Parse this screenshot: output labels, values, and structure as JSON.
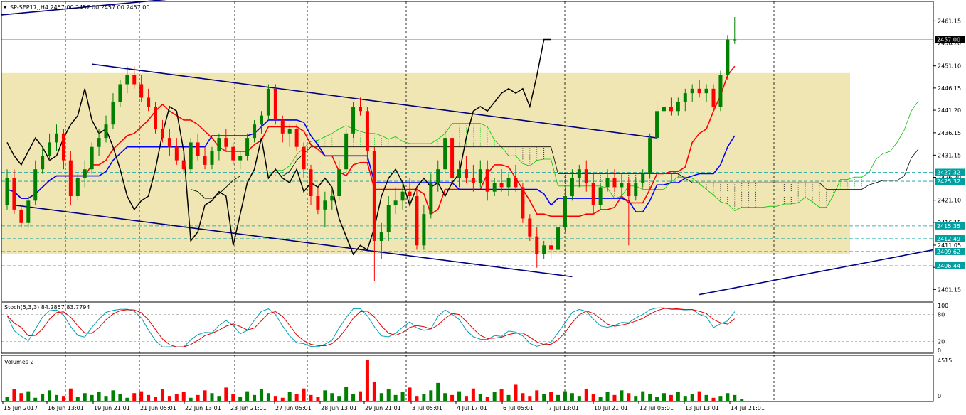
{
  "header": {
    "symbol_line": "SP-SEP17,,H4  2457.00 2457.00 2457.00 2457.00"
  },
  "chart_data": {
    "type": "candlestick",
    "symbol": "SP-SEP17",
    "timeframe": "H4",
    "price_axis": {
      "ylim": [
        2398.5,
        2465.5
      ],
      "ticks": [
        "2461.15",
        "2456.20",
        "2451.10",
        "2446.15",
        "2441.20",
        "2436.15",
        "2431.15",
        "2426.20",
        "2421.10",
        "2416.15",
        "2411.05",
        "2406.10",
        "2401.15"
      ],
      "current_price": "2457.00",
      "level_labels": [
        "2427.32",
        "2425.32",
        "2415.35",
        "2412.49",
        "2409.62",
        "2406.44"
      ],
      "level_values": [
        2427.32,
        2425.32,
        2415.35,
        2412.49,
        2409.62,
        2406.44
      ]
    },
    "time_axis": {
      "labels": [
        "15 Jun 2017",
        "16 Jun 13:01",
        "19 Jun 21:01",
        "21 Jun 05:01",
        "22 Jun 13:01",
        "23 Jun 21:01",
        "27 Jun 05:01",
        "28 Jun 13:01",
        "29 Jun 21:01",
        "3 Jul 05:01",
        "4 Jul 17:01",
        "6 Jul 05:01",
        "7 Jul 13:01",
        "10 Jul 21:01",
        "12 Jul 05:01",
        "13 Jul 13:01",
        "14 Jul 21:01"
      ]
    },
    "zone": {
      "from": 2409.0,
      "to": 2449.5,
      "color": "#f0e6b4"
    },
    "candles": [
      [
        2420,
        2428,
        2419,
        2426
      ],
      [
        2426,
        2428,
        2418,
        2419
      ],
      [
        2419,
        2420,
        2415,
        2416
      ],
      [
        2416,
        2422,
        2415,
        2421
      ],
      [
        2421,
        2430,
        2420,
        2428
      ],
      [
        2428,
        2433,
        2427,
        2431
      ],
      [
        2431,
        2436,
        2430,
        2434
      ],
      [
        2434,
        2438,
        2432,
        2436
      ],
      [
        2436,
        2437,
        2428,
        2430
      ],
      [
        2430,
        2432,
        2420,
        2422
      ],
      [
        2422,
        2427,
        2421,
        2426
      ],
      [
        2426,
        2430,
        2424,
        2428
      ],
      [
        2428,
        2434,
        2427,
        2433
      ],
      [
        2433,
        2437,
        2431,
        2435
      ],
      [
        2435,
        2440,
        2434,
        2438
      ],
      [
        2438,
        2445,
        2437,
        2443
      ],
      [
        2443,
        2448,
        2442,
        2447
      ],
      [
        2447,
        2451,
        2445,
        2449
      ],
      [
        2449,
        2451,
        2446,
        2447
      ],
      [
        2447,
        2449,
        2443,
        2444
      ],
      [
        2444,
        2446,
        2441,
        2442
      ],
      [
        2442,
        2443,
        2436,
        2437
      ],
      [
        2437,
        2439,
        2434,
        2435
      ],
      [
        2435,
        2437,
        2431,
        2433
      ],
      [
        2433,
        2435,
        2429,
        2430
      ],
      [
        2430,
        2432,
        2427,
        2428
      ],
      [
        2428,
        2435,
        2427,
        2434
      ],
      [
        2434,
        2436,
        2430,
        2431
      ],
      [
        2431,
        2433,
        2428,
        2429
      ],
      [
        2429,
        2433,
        2428,
        2432
      ],
      [
        2432,
        2436,
        2430,
        2435
      ],
      [
        2435,
        2437,
        2432,
        2433
      ],
      [
        2433,
        2434,
        2429,
        2430
      ],
      [
        2430,
        2432,
        2428,
        2431
      ],
      [
        2431,
        2436,
        2430,
        2435
      ],
      [
        2435,
        2439,
        2434,
        2438
      ],
      [
        2438,
        2441,
        2436,
        2440
      ],
      [
        2440,
        2447,
        2439,
        2446
      ],
      [
        2446,
        2447,
        2438,
        2439
      ],
      [
        2439,
        2440,
        2434,
        2436
      ],
      [
        2436,
        2438,
        2433,
        2437
      ],
      [
        2437,
        2438,
        2432,
        2433
      ],
      [
        2433,
        2434,
        2426,
        2428
      ],
      [
        2428,
        2429,
        2420,
        2422
      ],
      [
        2422,
        2424,
        2418,
        2419
      ],
      [
        2419,
        2423,
        2415,
        2421
      ],
      [
        2421,
        2424,
        2419,
        2422
      ],
      [
        2422,
        2430,
        2421,
        2428
      ],
      [
        2428,
        2437,
        2427,
        2436
      ],
      [
        2436,
        2443,
        2435,
        2442
      ],
      [
        2442,
        2444,
        2440,
        2441
      ],
      [
        2441,
        2442,
        2430,
        2432
      ],
      [
        2432,
        2433,
        2403,
        2412
      ],
      [
        2412,
        2416,
        2408,
        2414
      ],
      [
        2414,
        2422,
        2412,
        2420
      ],
      [
        2420,
        2424,
        2418,
        2421
      ],
      [
        2421,
        2425,
        2419,
        2423
      ],
      [
        2423,
        2426,
        2420,
        2422
      ],
      [
        2422,
        2424,
        2410,
        2411
      ],
      [
        2411,
        2420,
        2410,
        2418
      ],
      [
        2418,
        2427,
        2417,
        2425
      ],
      [
        2425,
        2430,
        2423,
        2428
      ],
      [
        2428,
        2437,
        2427,
        2435
      ],
      [
        2435,
        2436,
        2424,
        2426
      ],
      [
        2426,
        2430,
        2424,
        2428
      ],
      [
        2428,
        2431,
        2425,
        2426
      ],
      [
        2426,
        2429,
        2423,
        2425
      ],
      [
        2425,
        2430,
        2424,
        2428
      ],
      [
        2428,
        2430,
        2421,
        2423
      ],
      [
        2423,
        2426,
        2422,
        2425
      ],
      [
        2425,
        2428,
        2423,
        2424
      ],
      [
        2424,
        2427,
        2422,
        2426
      ],
      [
        2426,
        2429,
        2423,
        2424
      ],
      [
        2424,
        2425,
        2416,
        2417
      ],
      [
        2417,
        2418,
        2412,
        2413
      ],
      [
        2413,
        2415,
        2406,
        2409
      ],
      [
        2409,
        2412,
        2408,
        2411
      ],
      [
        2411,
        2413,
        2408,
        2410
      ],
      [
        2410,
        2416,
        2409,
        2415
      ],
      [
        2415,
        2424,
        2414,
        2422
      ],
      [
        2422,
        2428,
        2421,
        2426
      ],
      [
        2426,
        2429,
        2424,
        2428
      ],
      [
        2428,
        2430,
        2423,
        2425
      ],
      [
        2425,
        2427,
        2418,
        2420
      ],
      [
        2420,
        2425,
        2419,
        2424
      ],
      [
        2424,
        2428,
        2423,
        2426
      ],
      [
        2426,
        2428,
        2423,
        2424
      ],
      [
        2424,
        2427,
        2422,
        2425
      ],
      [
        2425,
        2426,
        2411,
        2422
      ],
      [
        2422,
        2426,
        2421,
        2425
      ],
      [
        2425,
        2428,
        2424,
        2427
      ],
      [
        2427,
        2436,
        2426,
        2435
      ],
      [
        2435,
        2443,
        2434,
        2441
      ],
      [
        2441,
        2443,
        2439,
        2442
      ],
      [
        2442,
        2444,
        2440,
        2441
      ],
      [
        2441,
        2444,
        2440,
        2443
      ],
      [
        2443,
        2446,
        2441,
        2445
      ],
      [
        2445,
        2447,
        2443,
        2446
      ],
      [
        2446,
        2448,
        2444,
        2445
      ],
      [
        2445,
        2447,
        2443,
        2446
      ],
      [
        2446,
        2447,
        2441,
        2442
      ],
      [
        2442,
        2450,
        2441,
        2449
      ],
      [
        2449,
        2458,
        2448,
        2457
      ],
      [
        2457,
        2462,
        2456,
        2457
      ]
    ],
    "indicators": [
      "ichimoku-tenkan",
      "ichimoku-kijun",
      "ichimoku-chikou",
      "ichimoku-cloud",
      "trend-channel"
    ],
    "stochastic": {
      "label": "Stoch(5,3,3) 84.2857 83.7794",
      "ticks": [
        "100",
        "80",
        "20",
        "0"
      ],
      "main_color": "#00a0b4",
      "signal_color": "#e00000"
    },
    "volumes": {
      "label": "Volumes 2",
      "ticks": [
        "4515",
        "0"
      ],
      "values": [
        500,
        1300,
        900,
        1100,
        400,
        800,
        1200,
        700,
        600,
        1400,
        500,
        900,
        700,
        1000,
        600,
        1200,
        800,
        400,
        900,
        1100,
        700,
        500,
        1300,
        600,
        800,
        1000,
        400,
        700,
        1200,
        900,
        600,
        1500,
        800,
        500,
        1100,
        700,
        1300,
        900,
        600,
        400,
        1000,
        800,
        1400,
        700,
        500,
        1200,
        900,
        600,
        1600,
        800,
        1100,
        4515,
        2100,
        900,
        1300,
        700,
        1000,
        1500,
        600,
        800,
        1200,
        2000,
        900,
        700,
        1100,
        600,
        1400,
        800,
        500,
        1000,
        1300,
        700,
        1800,
        900,
        600,
        1200,
        800,
        1000,
        700,
        1100,
        900,
        600,
        1300,
        800,
        500,
        1000,
        700,
        1200,
        900,
        600,
        1100,
        800,
        500,
        900,
        700,
        1000,
        600,
        800,
        1100,
        700,
        400,
        600,
        900,
        700,
        300
      ],
      "up_color": "#008000",
      "down_color": "#ff0000"
    },
    "colors": {
      "bull": "#008000",
      "bear": "#ff0000",
      "tenkan": "#ff0000",
      "kijun": "#0000ff",
      "chikou": "#000000",
      "cloud_up": "#00c800",
      "cloud_down": "#000000",
      "channel": "#000080",
      "level": "#00a0a0"
    }
  }
}
